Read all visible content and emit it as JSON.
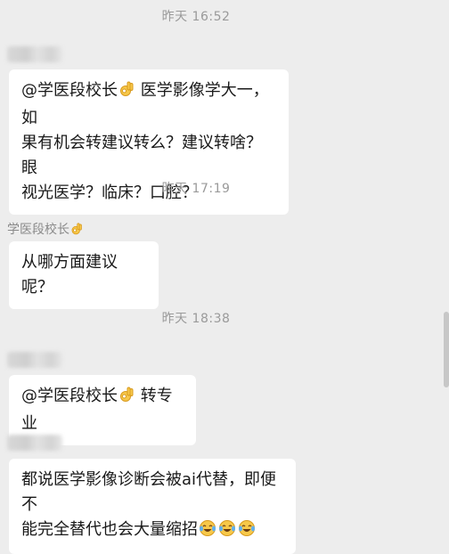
{
  "messages": {
    "t1": "昨天 16:52",
    "m1_line1_a": "@学医段校长",
    "m1_line1_b": " 医学影像学大一，如",
    "m1_line2": "果有机会转建议转么？建议转啥？眼",
    "m1_line3": "视光医学？临床？口腔？",
    "t2": "昨天 17:19",
    "reply_sender": "学医段校长",
    "m2": "从哪方面建议呢？",
    "t3": "昨天 18:38",
    "m3_a": "@学医段校长",
    "m3_b": " 转专业",
    "m4_line1": "都说医学影像诊断会被ai代替，即便不",
    "m4_line2": "能完全替代也会大量缩招"
  },
  "icons": {
    "ok_hand": "ok-hand-emoji",
    "laugh_cry": "face-with-tears-of-joy-emoji"
  },
  "colors": {
    "background": "#ededed",
    "bubble": "#ffffff",
    "timestamp": "#9a9a9a"
  }
}
